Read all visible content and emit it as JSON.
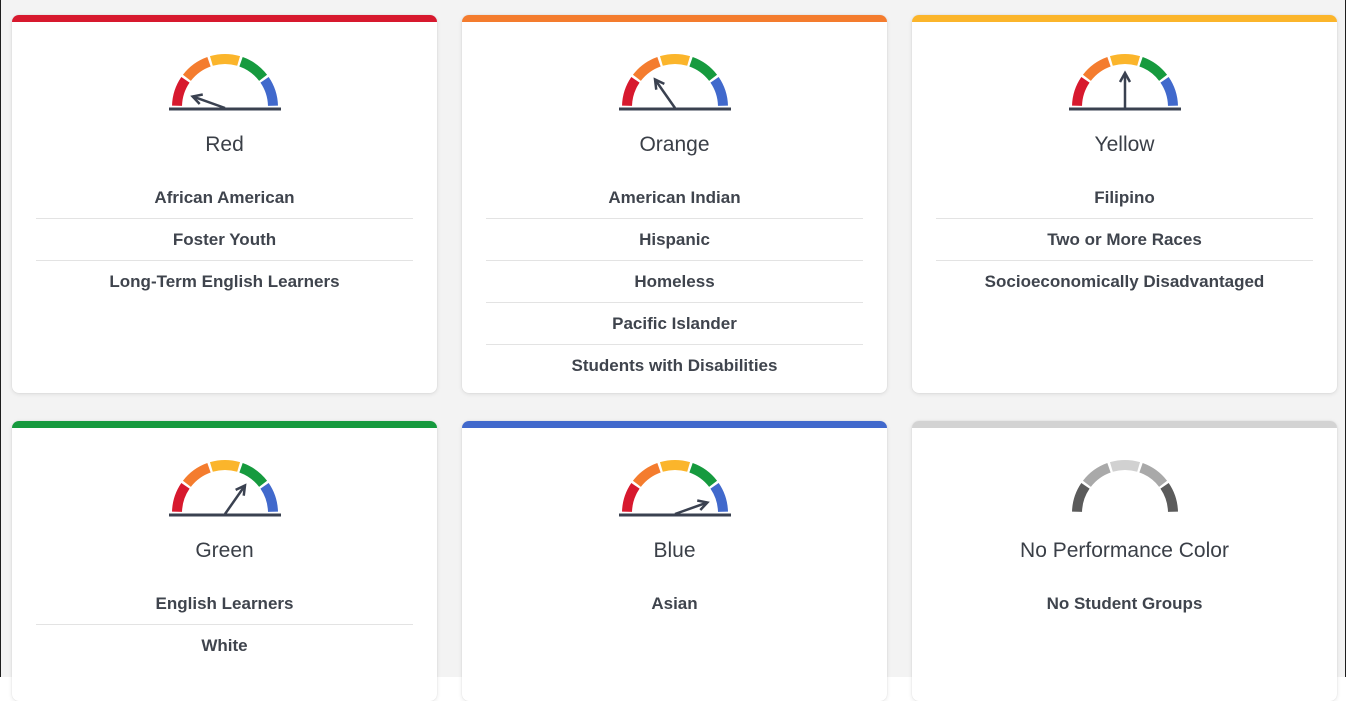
{
  "colors": {
    "red": "#d7192e",
    "orange": "#f47c2e",
    "yellow": "#fbb52b",
    "green": "#169a3e",
    "blue": "#4169cc",
    "gray": "#d3d3d3",
    "needle": "#3a4150"
  },
  "cards": [
    {
      "id": "red",
      "title": "Red",
      "accent": "#d7192e",
      "gauge_icon": "performance-gauge-red-icon",
      "gauge_level": 1,
      "groups": [
        "African American",
        "Foster Youth",
        "Long-Term English Learners"
      ]
    },
    {
      "id": "orange",
      "title": "Orange",
      "accent": "#f47c2e",
      "gauge_icon": "performance-gauge-orange-icon",
      "gauge_level": 2,
      "groups": [
        "American Indian",
        "Hispanic",
        "Homeless",
        "Pacific Islander",
        "Students with Disabilities"
      ]
    },
    {
      "id": "yellow",
      "title": "Yellow",
      "accent": "#fbb52b",
      "gauge_icon": "performance-gauge-yellow-icon",
      "gauge_level": 3,
      "groups": [
        "Filipino",
        "Two or More Races",
        "Socioeconomically Disadvantaged"
      ]
    },
    {
      "id": "green",
      "title": "Green",
      "accent": "#169a3e",
      "gauge_icon": "performance-gauge-green-icon",
      "gauge_level": 4,
      "groups": [
        "English Learners",
        "White"
      ]
    },
    {
      "id": "blue",
      "title": "Blue",
      "accent": "#4169cc",
      "gauge_icon": "performance-gauge-blue-icon",
      "gauge_level": 5,
      "groups": [
        "Asian"
      ]
    },
    {
      "id": "none",
      "title": "No Performance Color",
      "accent": "#d3d3d3",
      "gauge_icon": "performance-gauge-gray-icon",
      "gauge_level": 0,
      "groups": [
        "No Student Groups"
      ]
    }
  ]
}
